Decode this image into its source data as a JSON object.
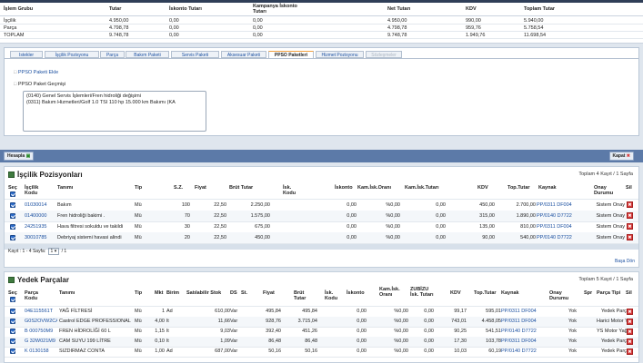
{
  "summary": {
    "headers": [
      "İşlem Grubu",
      "Tutar",
      "İskonto Tutarı",
      "Kampanya İskonto Tutarı",
      "Net Tutarı",
      "KDV",
      "Toplam Tutar"
    ],
    "rows": [
      [
        "İşçilik",
        "4.950,00",
        "0,00",
        "0,00",
        "4.950,00",
        "990,00",
        "5.940,00"
      ],
      [
        "Parça",
        "4.798,78",
        "0,00",
        "0,00",
        "4.798,78",
        "959,76",
        "5.758,54"
      ],
      [
        "TOPLAM",
        "9.748,78",
        "0,00",
        "0,00",
        "9.748,78",
        "1.949,76",
        "11.698,54"
      ]
    ]
  },
  "tabs": [
    {
      "label": "Istekler"
    },
    {
      "label": "İşçilik Pozisyonu"
    },
    {
      "label": "Parça"
    },
    {
      "label": "Bakım Paketi"
    },
    {
      "label": "Servis Paketi"
    },
    {
      "label": "Aksesuar Paketi"
    },
    {
      "label": "PPSO Paketleri"
    },
    {
      "label": "Hizmet Pozisyonu"
    },
    {
      "label": "Sözleşmeler"
    }
  ],
  "ppso": {
    "add_link": "PPSO Paketi Ekle",
    "history_label": "PPSO Paket Geçmişi",
    "history_items": [
      "(0140) Genel Servis İşlemleri/Fren hidroliği değişimi",
      "(0311) Bakım Hizmetleri/Golf 1.0 TSI 110 hp 15.000 km Bakımı (KA"
    ]
  },
  "actions": {
    "calculate": "Hesapla",
    "close": "Kapat"
  },
  "labor": {
    "title": "İşçilik Pozisyonları",
    "info": "Toplam 4 Kayıt / 1 Sayfa",
    "headers": [
      "Seç",
      "İşçilik Kodu",
      "Tanımı",
      "Tip",
      "S.Z.",
      "Fiyat",
      "Brüt Tutar",
      "İsk. Kodu",
      "İskonto",
      "Kam.İsk.Oranı",
      "Kam.İsk.Tutarı",
      "KDV",
      "Top.Tutar",
      "Kaynak",
      "Onay Durumu",
      "Sil"
    ],
    "rows": [
      [
        "01030014",
        "Bakım",
        "Mü",
        "100",
        "22,50",
        "2.250,00",
        "",
        "0,00",
        "%0,00",
        "0,00",
        "450,00",
        "2.700,00",
        "PP/0311 DF004",
        "Sistem Onay"
      ],
      [
        "01400000",
        "Fren hidroliği bakimi .",
        "Mü",
        "70",
        "22,50",
        "1.575,00",
        "",
        "0,00",
        "%0,00",
        "0,00",
        "315,00",
        "1.890,00",
        "PP/0140 D7722",
        "Sistem Onay"
      ],
      [
        "24251935",
        "Hava filtresi sokuldu ve takildi",
        "Mü",
        "30",
        "22,50",
        "675,00",
        "",
        "0,00",
        "%0,00",
        "0,00",
        "135,00",
        "810,00",
        "PP/0311 DF004",
        "Sistem Onay"
      ],
      [
        "30010785",
        "Debriyaj sistemi havasi alindi",
        "Mü",
        "20",
        "22,50",
        "450,00",
        "",
        "0,00",
        "%0,00",
        "0,00",
        "90,00",
        "540,00",
        "PP/0140 D7722",
        "Sistem Onay"
      ]
    ],
    "pager_label": "Kayıt : 1 - 4 Sayfa:",
    "pager_page": "1",
    "pager_total": "/ 1",
    "top_link": "Başa Dön"
  },
  "parts": {
    "title": "Yedek Parçalar",
    "info": "Toplam 5 Kayıt / 1 Sayfa",
    "headers": [
      "Seç",
      "Parça Kodu",
      "Tanımı",
      "Tip",
      "Mkt",
      "Birim",
      "Satılabilir Stok",
      "DS",
      "St.",
      "Fiyat",
      "Brüt Tutar",
      "İsk. Kodu",
      "İskonto",
      "Kam.İsk. Oranı",
      "ZUBİZU İsk. Tutarı",
      "KDV",
      "Top.Tutar",
      "Kaynak",
      "Onay Durumu",
      "Spr",
      "Parça Tipi",
      "Sil"
    ],
    "rows": [
      [
        "04E115561T",
        "YAĞ FİLTRESİ",
        "Mü",
        "1",
        "Ad",
        "610,00",
        "Var",
        "495,84",
        "495,84",
        "",
        "0,00",
        "%0,00",
        "0,00",
        "99,17",
        "595,01",
        "PP/0311 DF004",
        "Yok",
        "Yedek Parça"
      ],
      [
        "G0S2OVW2CA",
        "Castrol EDGE PROFESSIONAL",
        "Mü",
        "4,00",
        "lt",
        "11,66",
        "Var",
        "928,76",
        "3.715,04",
        "",
        "0,00",
        "%0,00",
        "0,00",
        "743,01",
        "4.458,05",
        "PP/0311 DF004",
        "Yok",
        "Harici Motor Yağları"
      ],
      [
        "B 000750M9",
        "FREN HİDROLİĞİ 60 L",
        "Mü",
        "1,15",
        "lt",
        "9,03",
        "Var",
        "392,40",
        "451,26",
        "",
        "0,00",
        "%0,00",
        "0,00",
        "90,25",
        "541,51",
        "PP/0140 D7722",
        "Yok",
        "YS Motor Yağları"
      ],
      [
        "G 32W021M9",
        "CAM SUYU 199 LİTRE",
        "Mü",
        "0,10",
        "lt",
        "1,09",
        "Var",
        "86,48",
        "86,48",
        "",
        "0,00",
        "%0,00",
        "0,00",
        "17,30",
        "103,78",
        "PP/0311 DF004",
        "Yok",
        "Yedek Parça"
      ],
      [
        "K 0130158",
        "SIZDIRMAZ CONTA",
        "Mü",
        "1,00",
        "Ad",
        "687,00",
        "Var",
        "50,16",
        "50,16",
        "",
        "0,00",
        "%0,00",
        "0,00",
        "10,03",
        "60,19",
        "PP/0140 D7722",
        "Yok",
        "Yedek Parça"
      ]
    ]
  },
  "colors": {
    "accent": "#1a4fa0",
    "action_bar": "#5c7aa8",
    "delete": "#d83a3a"
  }
}
